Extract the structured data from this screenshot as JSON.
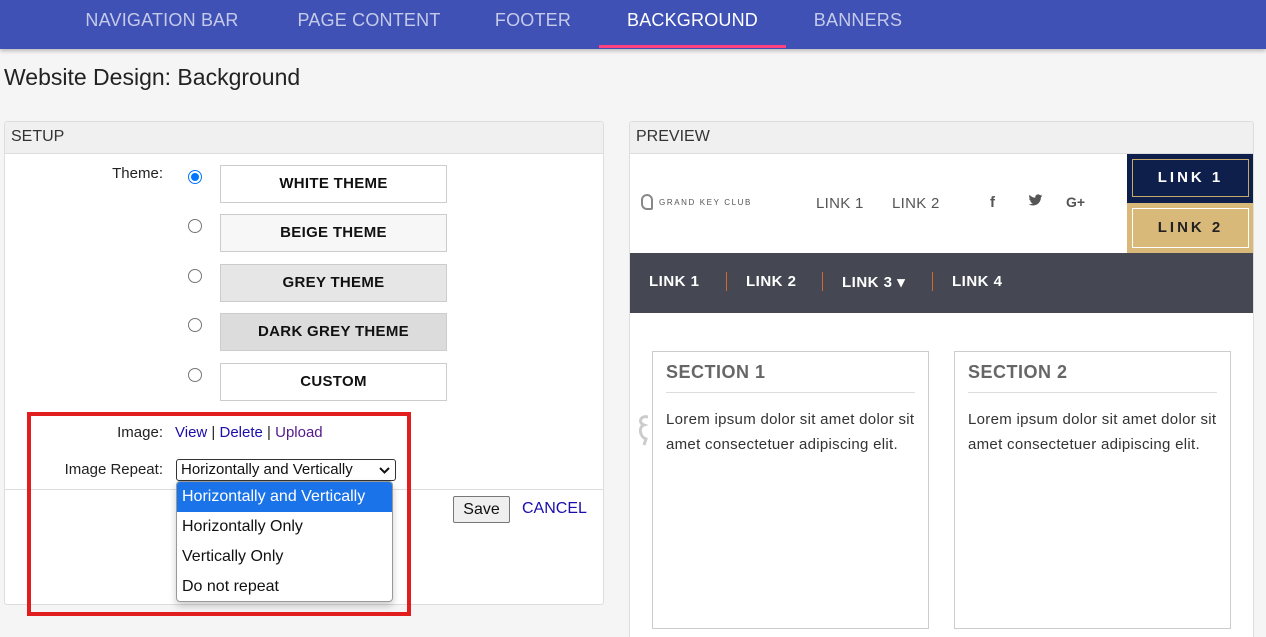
{
  "tabs": [
    {
      "label": "NAVIGATION BAR",
      "active": false
    },
    {
      "label": "PAGE CONTENT",
      "active": false
    },
    {
      "label": "FOOTER",
      "active": false
    },
    {
      "label": "BACKGROUND",
      "active": true
    },
    {
      "label": "BANNERS",
      "active": false
    }
  ],
  "page_title": "Website Design: Background",
  "setup": {
    "header": "SETUP",
    "theme_label": "Theme:",
    "themes": [
      {
        "label": "WHITE THEME",
        "selected": true,
        "color": "#ffffff"
      },
      {
        "label": "BEIGE THEME",
        "selected": false,
        "color": "#f7f7f7"
      },
      {
        "label": "GREY THEME",
        "selected": false,
        "color": "#e6e6e6"
      },
      {
        "label": "DARK GREY THEME",
        "selected": false,
        "color": "#dcdcdc"
      },
      {
        "label": "CUSTOM",
        "selected": false,
        "color": "#ffffff"
      }
    ],
    "image_label": "Image:",
    "image_links": {
      "view": "View",
      "delete": "Delete",
      "upload": "Upload",
      "separator": "|"
    },
    "repeat_label": "Image Repeat:",
    "repeat_selected": "Horizontally and Vertically",
    "repeat_options": [
      "Horizontally and Vertically",
      "Horizontally Only",
      "Vertically Only",
      "Do not repeat"
    ],
    "save_label": "Save",
    "cancel_label": "CANCEL"
  },
  "preview": {
    "header": "PREVIEW",
    "logo_text": "GRAND KEY CLUB",
    "top_links": [
      "LINK 1",
      "LINK 2"
    ],
    "social_icons": [
      {
        "name": "facebook-icon",
        "glyph": "f"
      },
      {
        "name": "twitter-icon",
        "glyph": "🐦"
      },
      {
        "name": "google-plus-icon",
        "glyph": "G+"
      }
    ],
    "button_link1": "LINK 1",
    "button_link2": "LINK 2",
    "nav_links": [
      "LINK 1",
      "LINK 2",
      "LINK 3",
      "LINK 4"
    ],
    "nav_dropdown_glyph": "▾",
    "sections": [
      {
        "title": "SECTION 1",
        "body": "Lorem ipsum dolor sit amet dolor sit amet consectetuer adipiscing elit."
      },
      {
        "title": "SECTION 2",
        "body": "Lorem ipsum dolor sit amet dolor sit amet consectetuer adipiscing elit."
      }
    ]
  },
  "colors": {
    "topbar": "#3f51b5",
    "tab_indicator": "#ff4081",
    "highlight_box": "#e11d1d",
    "preview_nav": "#454852",
    "link1_bg": "#0d1f4a",
    "link2_bg": "#d9b97a"
  }
}
